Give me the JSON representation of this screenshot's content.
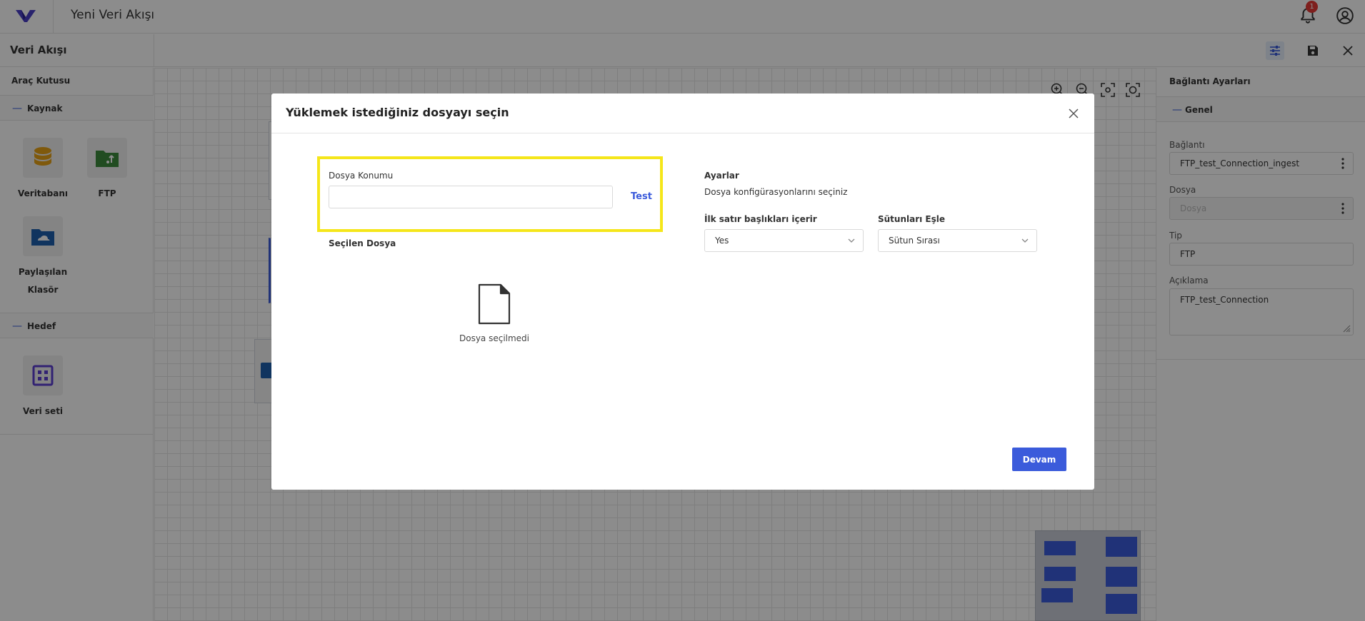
{
  "header": {
    "app_title": "Yeni Veri Akışı",
    "notification_count": "1"
  },
  "subheader": {
    "flow_title": "Veri Akışı"
  },
  "toolbox": {
    "title": "Araç Kutusu",
    "groups": [
      {
        "label": "Kaynak",
        "items": [
          {
            "label": "Veritabanı",
            "icon": "database-icon",
            "color": "#e8a317"
          },
          {
            "label": "FTP",
            "icon": "ftp-folder-icon",
            "color": "#3c8a3c"
          },
          {
            "label": "Paylaşılan Klasör",
            "icon": "shared-folder-icon",
            "color": "#1e5fae"
          }
        ]
      },
      {
        "label": "Hedef",
        "items": [
          {
            "label": "Veri seti",
            "icon": "dataset-grid-icon",
            "color": "#5b3fd1"
          }
        ]
      }
    ]
  },
  "right_panel": {
    "title": "Bağlantı Ayarları",
    "section": "Genel",
    "fields": {
      "connection_label": "Bağlantı",
      "connection_value": "FTP_test_Connection_ingest",
      "file_label": "Dosya",
      "file_placeholder": "Dosya",
      "type_label": "Tip",
      "type_value": "FTP",
      "description_label": "Açıklama",
      "description_value": "FTP_test_Connection"
    }
  },
  "modal": {
    "title": "Yüklemek istediğiniz dosyayı seçin",
    "file_location_label": "Dosya Konumu",
    "file_location_value": "",
    "test_label": "Test",
    "selected_file_label": "Seçilen Dosya",
    "no_file_text": "Dosya seçilmedi",
    "settings_title": "Ayarlar",
    "settings_subtitle": "Dosya konfigürasyonlarını seçiniz",
    "header_row_label": "İlk satır başlıkları içerir",
    "header_row_value": "Yes",
    "map_columns_label": "Sütunları Eşle",
    "map_columns_value": "Sütun Sırası",
    "continue_label": "Devam"
  },
  "colors": {
    "accent": "#3b5bdb",
    "highlight": "#f5e61a",
    "badge": "#e53935"
  }
}
